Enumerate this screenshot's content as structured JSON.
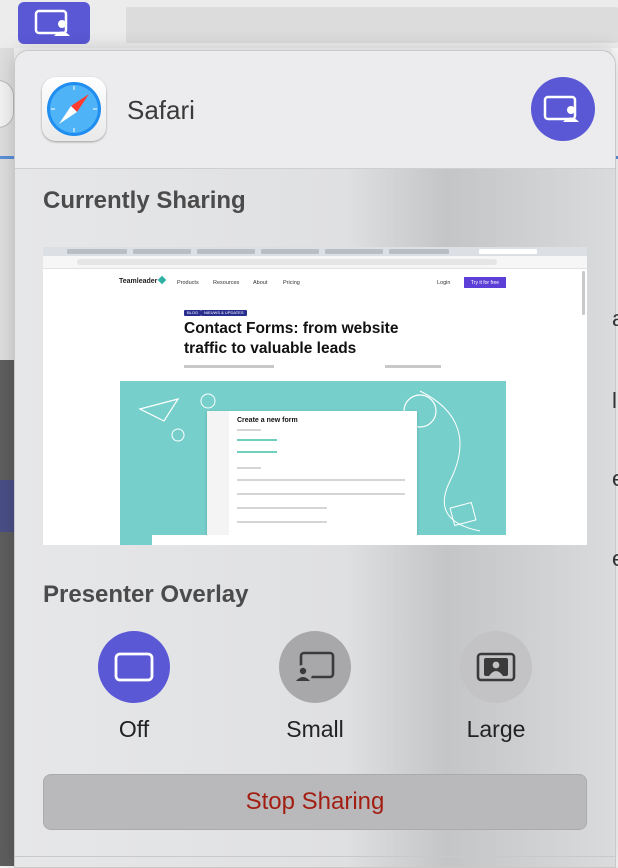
{
  "app": {
    "name": "Safari",
    "app_icon": "safari-compass-icon",
    "share_icon": "screen-share-person-icon"
  },
  "sharing": {
    "title": "Currently Sharing",
    "preview": {
      "nav_logo": "Teamleader",
      "nav_items": [
        "Products",
        "Resources",
        "About",
        "Pricing"
      ],
      "nav_login": "Login",
      "nav_cta": "Try it for free",
      "tags": [
        "BLOG",
        "NIEUWS & UPDATES"
      ],
      "article_title": "Contact Forms: from website traffic to valuable leads",
      "hero_card_title": "Create a new form"
    }
  },
  "overlay": {
    "title": "Presenter Overlay",
    "options": [
      {
        "label": "Off",
        "icon": "overlay-off-icon",
        "selected": true
      },
      {
        "label": "Small",
        "icon": "overlay-small-icon",
        "selected": false
      },
      {
        "label": "Large",
        "icon": "overlay-large-icon",
        "selected": false
      }
    ]
  },
  "stop_button": {
    "label": "Stop Sharing"
  },
  "colors": {
    "accent": "#5b58d6",
    "stop_text": "#a31e12",
    "teal": "#76cfcb"
  }
}
